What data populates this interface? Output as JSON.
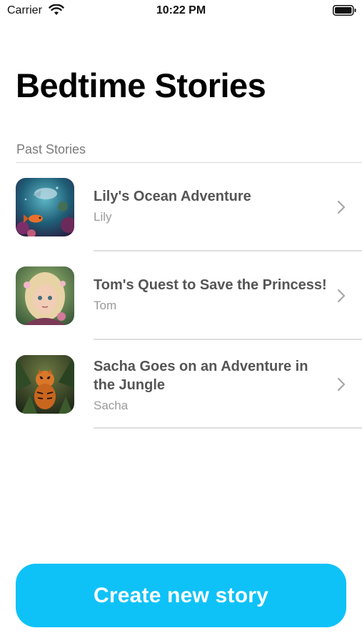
{
  "status_bar": {
    "carrier": "Carrier",
    "time": "10:22 PM",
    "wifi_icon": "wifi-icon",
    "battery_icon": "battery-icon"
  },
  "page": {
    "title": "Bedtime Stories"
  },
  "past_stories": {
    "header": "Past Stories",
    "items": [
      {
        "title": "Lily's Ocean Adventure",
        "subtitle": "Lily",
        "thumbnail": "ocean-fish-thumbnail"
      },
      {
        "title": "Tom's Quest to Save the Princess!",
        "subtitle": "Tom",
        "thumbnail": "princess-girl-thumbnail"
      },
      {
        "title": "Sacha Goes on an Adventure in the Jungle",
        "subtitle": "Sacha",
        "thumbnail": "jungle-tiger-thumbnail"
      }
    ]
  },
  "actions": {
    "create_label": "Create new story"
  },
  "colors": {
    "accent": "#0ec2f8",
    "title_text": "#555555",
    "subtitle_text": "#9a9a9a",
    "section_header": "#7b7b7b",
    "divider": "#dedede"
  }
}
